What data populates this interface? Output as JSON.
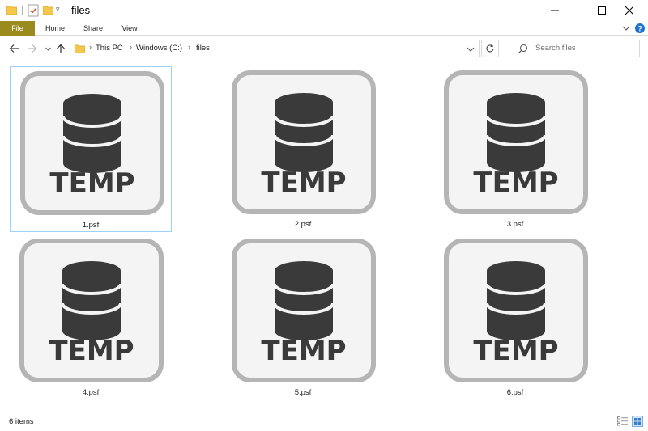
{
  "window": {
    "title": "files"
  },
  "ribbon": {
    "tabs": [
      {
        "label": "File",
        "active": true
      },
      {
        "label": "Home"
      },
      {
        "label": "Share"
      },
      {
        "label": "View"
      }
    ]
  },
  "address_bar": {
    "breadcrumbs": [
      "This PC",
      "Windows (C:)",
      "files"
    ]
  },
  "search": {
    "placeholder": "Search files"
  },
  "files": [
    {
      "name": "1.psf",
      "icon_text": "TEMP",
      "icon": "temp-database-file-icon",
      "selected": true
    },
    {
      "name": "2.psf",
      "icon_text": "TEMP",
      "icon": "temp-database-file-icon"
    },
    {
      "name": "3.psf",
      "icon_text": "TEMP",
      "icon": "temp-database-file-icon"
    },
    {
      "name": "4.psf",
      "icon_text": "TEMP",
      "icon": "temp-database-file-icon"
    },
    {
      "name": "5.psf",
      "icon_text": "TEMP",
      "icon": "temp-database-file-icon"
    },
    {
      "name": "6.psf",
      "icon_text": "TEMP",
      "icon": "temp-database-file-icon"
    }
  ],
  "status": {
    "item_count": "6 items"
  },
  "colors": {
    "file_tab": "#9b8a1d",
    "selection_border": "#99d1ff",
    "icon_frame": "#b5b5b5",
    "icon_glyph": "#3a3a3a"
  }
}
